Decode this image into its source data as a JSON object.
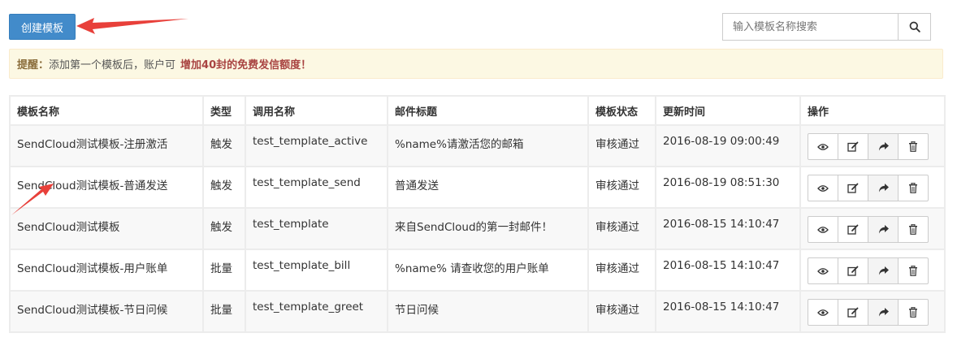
{
  "toolbar": {
    "create_label": "创建模板",
    "search_placeholder": "输入模板名称搜索",
    "search_icon": "search-icon"
  },
  "alert": {
    "prefix": "提醒：",
    "text": "添加第一个模板后，账户可",
    "highlight": "增加40封的免费发信额度！"
  },
  "table": {
    "headers": [
      "模板名称",
      "类型",
      "调用名称",
      "邮件标题",
      "模板状态",
      "更新时间",
      "操作"
    ],
    "rows": [
      [
        "SendCloud测试模板-注册激活",
        "触发",
        "test_template_active",
        "%name%请激活您的邮箱",
        "审核通过",
        "2016-08-19 09:00:49"
      ],
      [
        "SendCloud测试模板-普通发送",
        "触发",
        "test_template_send",
        "普通发送",
        "审核通过",
        "2016-08-19 08:51:30"
      ],
      [
        "SendCloud测试模板",
        "触发",
        "test_template",
        "来自SendCloud的第一封邮件！",
        "审核通过",
        "2016-08-15 14:10:47"
      ],
      [
        "SendCloud测试模板-用户账单",
        "批量",
        "test_template_bill",
        "%name% 请查收您的用户账单",
        "审核通过",
        "2016-08-15 14:10:47"
      ],
      [
        "SendCloud测试模板-节日问候",
        "批量",
        "test_template_greet",
        "节日问候",
        "审核通过",
        "2016-08-15 14:10:47"
      ]
    ],
    "action_icons": [
      "eye-icon",
      "edit-icon",
      "share-icon",
      "trash-icon"
    ]
  },
  "colors": {
    "primary": "#428bca",
    "alert_bg": "#fcf8e3",
    "alert_highlight": "#a94442",
    "annotation_arrow": "#e8403a"
  }
}
